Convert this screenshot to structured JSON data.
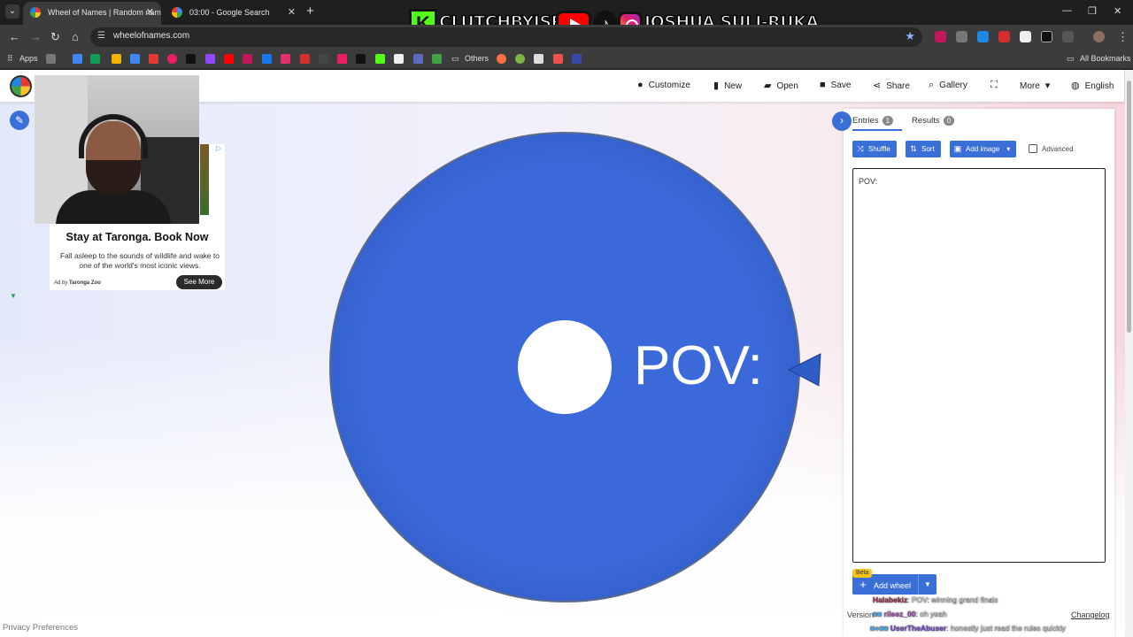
{
  "browser": {
    "tabs": [
      {
        "title": "Wheel of Names | Random nam",
        "active": true
      },
      {
        "title": "03:00 - Google Search",
        "active": false
      }
    ],
    "url": "wheelofnames.com",
    "bookmarks": {
      "apps_label": "Apps",
      "others_label": "Others",
      "all_label": "All Bookmarks"
    }
  },
  "overlay": {
    "k_letter": "K",
    "kick_name": "CLUTCHBYJSR",
    "social_name": "JOSHUA SULI-RUKA"
  },
  "app": {
    "menu": {
      "customize": "Customize",
      "new": "New",
      "open": "Open",
      "save": "Save",
      "share": "Share",
      "gallery": "Gallery",
      "more": "More",
      "language": "English"
    },
    "ad": {
      "title": "Stay at Taronga. Book Now",
      "description": "Fall asleep to the sounds of wildlife and wake to one of the world's most iconic views.",
      "by_prefix": "Ad by",
      "advertiser": "Taronga Zoo",
      "cta": "See More"
    },
    "wheel": {
      "segment_label": "POV:",
      "color": "#3c69d9"
    },
    "footer": {
      "privacy": "Privacy Preferences"
    },
    "sidebar": {
      "entries_tab": "Entries",
      "entries_count": "1",
      "results_tab": "Results",
      "results_count": "0",
      "shuffle": "Shuffle",
      "sort": "Sort",
      "add_image": "Add image",
      "advanced": "Advanced",
      "entries_text": "POV:",
      "beta": "Beta",
      "add_wheel": "Add wheel",
      "version": "Version",
      "changelog": "Changelog"
    },
    "chat": [
      {
        "user": "Halabekiz",
        "message": ": POV: winning grand finals"
      },
      {
        "user": "rileez_00",
        "message": ": oh yeah"
      },
      {
        "user": "UserTheAbuser",
        "message": ": honestly just read the rules quickly"
      }
    ],
    "accent_color": "#3b6fd8"
  }
}
